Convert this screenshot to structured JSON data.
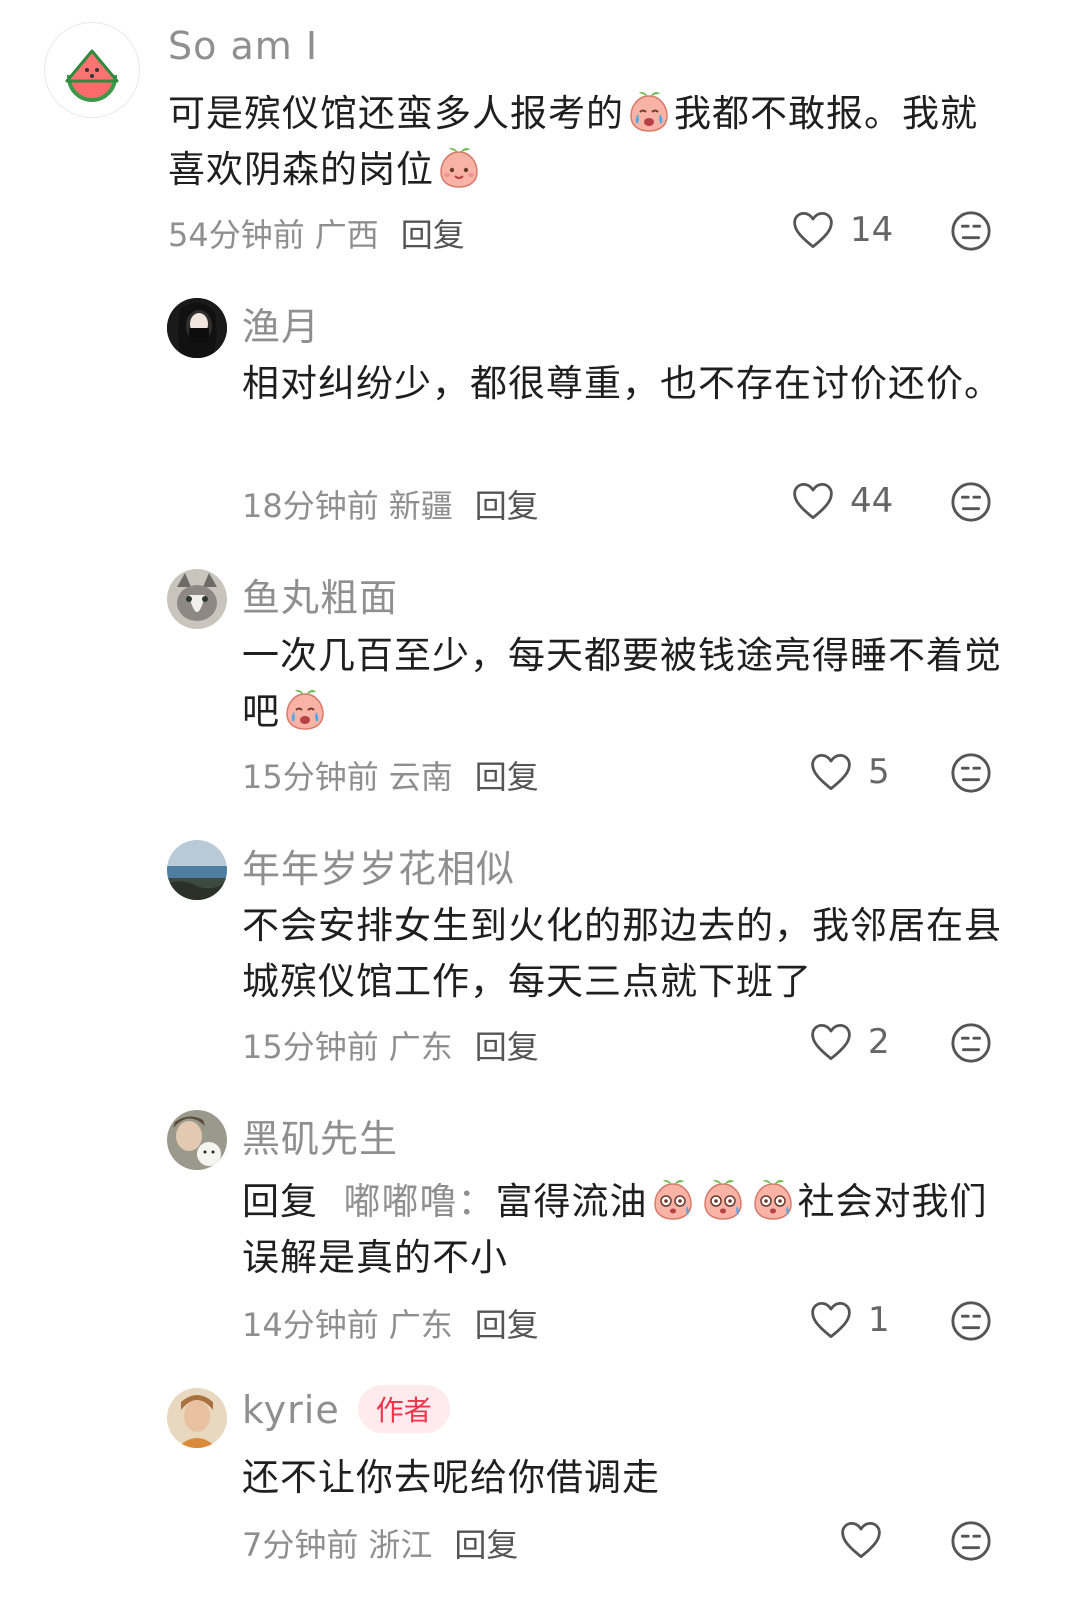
{
  "comments": [
    {
      "user": "So am I",
      "text_parts": [
        "可是殡仪馆还蛮多人报考的",
        "我都不敢报。我就喜欢阴森的岗位"
      ],
      "time": "54分钟前",
      "location": "广西",
      "reply_label": "回复",
      "likes": "14"
    },
    {
      "user": "渔月",
      "text": "相对纠纷少，都很尊重，也不存在讨价还价。",
      "time": "18分钟前",
      "location": "新疆",
      "reply_label": "回复",
      "likes": "44"
    },
    {
      "user": "鱼丸粗面",
      "text": "一次几百至少，每天都要被钱途亮得睡不着觉吧",
      "time": "15分钟前",
      "location": "云南",
      "reply_label": "回复",
      "likes": "5"
    },
    {
      "user": "年年岁岁花相似",
      "text": "不会安排女生到火化的那边去的，我邻居在县城殡仪馆工作，每天三点就下班了",
      "time": "15分钟前",
      "location": "广东",
      "reply_label": "回复",
      "likes": "2"
    },
    {
      "user": "黑矶先生",
      "reply_prefix": "回复",
      "reply_target": "嘟嘟噜：",
      "text_parts": [
        "富得流油",
        "社会对我们误解是真的不小"
      ],
      "time": "14分钟前",
      "location": "广东",
      "reply_label": "回复",
      "likes": "1"
    },
    {
      "user": "kyrie",
      "badge": "作者",
      "text": "还不让你去呢给你借调走",
      "time": "7分钟前",
      "location": "浙江",
      "reply_label": "回复",
      "likes": ""
    }
  ],
  "icons": {
    "like": "heart-outline-icon",
    "dislike": "meh-face-icon",
    "emoji_cry": "crying-peach-emoji",
    "emoji_smile": "smiling-peach-emoji",
    "emoji_dizzy": "dizzy-peach-emoji"
  },
  "colors": {
    "author_badge_bg": "#fdebed",
    "author_badge_text": "#f0354b",
    "secondary_text": "#8f8f8f"
  }
}
